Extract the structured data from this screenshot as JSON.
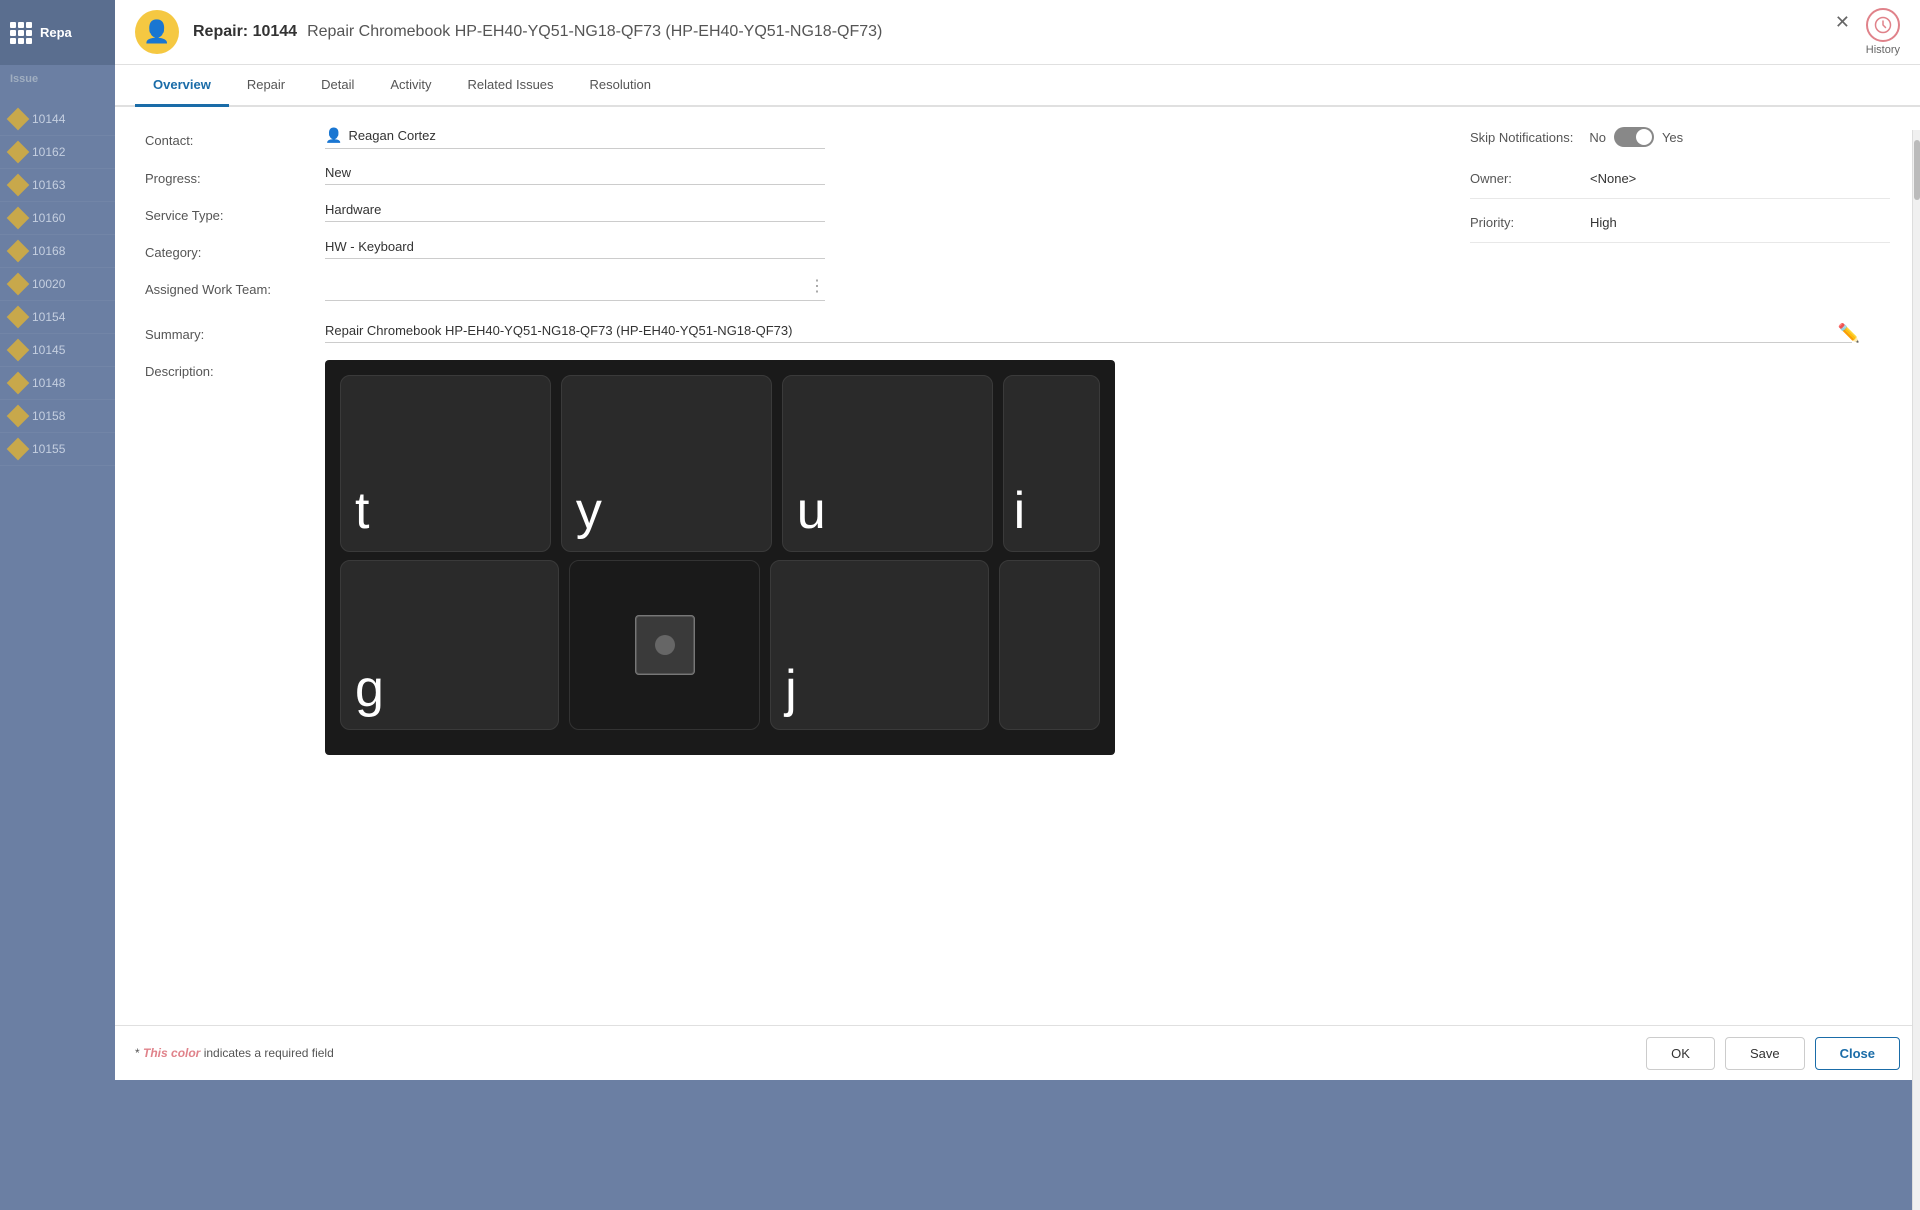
{
  "app": {
    "title": "Repa"
  },
  "sidebar": {
    "icon": "grid-icon",
    "items": [
      {
        "id": "10144",
        "label": "10144"
      },
      {
        "id": "10162",
        "label": "10162"
      },
      {
        "id": "10163",
        "label": "10163"
      },
      {
        "id": "10160",
        "label": "10160"
      },
      {
        "id": "10168",
        "label": "10168"
      },
      {
        "id": "10020",
        "label": "10020"
      },
      {
        "id": "10154",
        "label": "10154"
      },
      {
        "id": "10145",
        "label": "10145"
      },
      {
        "id": "10148",
        "label": "10148"
      },
      {
        "id": "10158",
        "label": "10158"
      },
      {
        "id": "10155",
        "label": "10155"
      }
    ],
    "column_header": "Issue"
  },
  "modal": {
    "title_prefix": "Repair: 10144",
    "title_desc": "Repair Chromebook HP-EH40-YQ51-NG18-QF73 (HP-EH40-YQ51-NG18-QF73)",
    "history_label": "History",
    "close_symbol": "✕",
    "avatar_emoji": "👤"
  },
  "tabs": [
    {
      "id": "overview",
      "label": "Overview",
      "active": true
    },
    {
      "id": "repair",
      "label": "Repair"
    },
    {
      "id": "detail",
      "label": "Detail"
    },
    {
      "id": "activity",
      "label": "Activity"
    },
    {
      "id": "related-issues",
      "label": "Related Issues"
    },
    {
      "id": "resolution",
      "label": "Resolution"
    }
  ],
  "form": {
    "contact_label": "Contact:",
    "contact_icon": "👤",
    "contact_value": "Reagan Cortez",
    "progress_label": "Progress:",
    "progress_value": "New",
    "service_type_label": "Service Type:",
    "service_type_value": "Hardware",
    "category_label": "Category:",
    "category_value": "HW - Keyboard",
    "assigned_work_team_label": "Assigned Work Team:",
    "assigned_work_team_value": "",
    "summary_label": "Summary:",
    "summary_value": "Repair Chromebook HP-EH40-YQ51-NG18-QF73 (HP-EH40-YQ51-NG18-QF73)",
    "description_label": "Description:",
    "skip_notifications_label": "Skip Notifications:",
    "skip_no": "No",
    "skip_yes": "Yes",
    "owner_label": "Owner:",
    "owner_value": "<None>",
    "priority_label": "Priority:",
    "priority_value": "High"
  },
  "footer": {
    "note_prefix": "* ",
    "note_color_text": "This color",
    "note_suffix": " indicates a required field",
    "ok_label": "OK",
    "save_label": "Save",
    "close_label": "Close"
  },
  "colors": {
    "accent_blue": "#1a6ca8",
    "accent_red": "#e0828a",
    "ticket_gold": "#c8a84b"
  }
}
